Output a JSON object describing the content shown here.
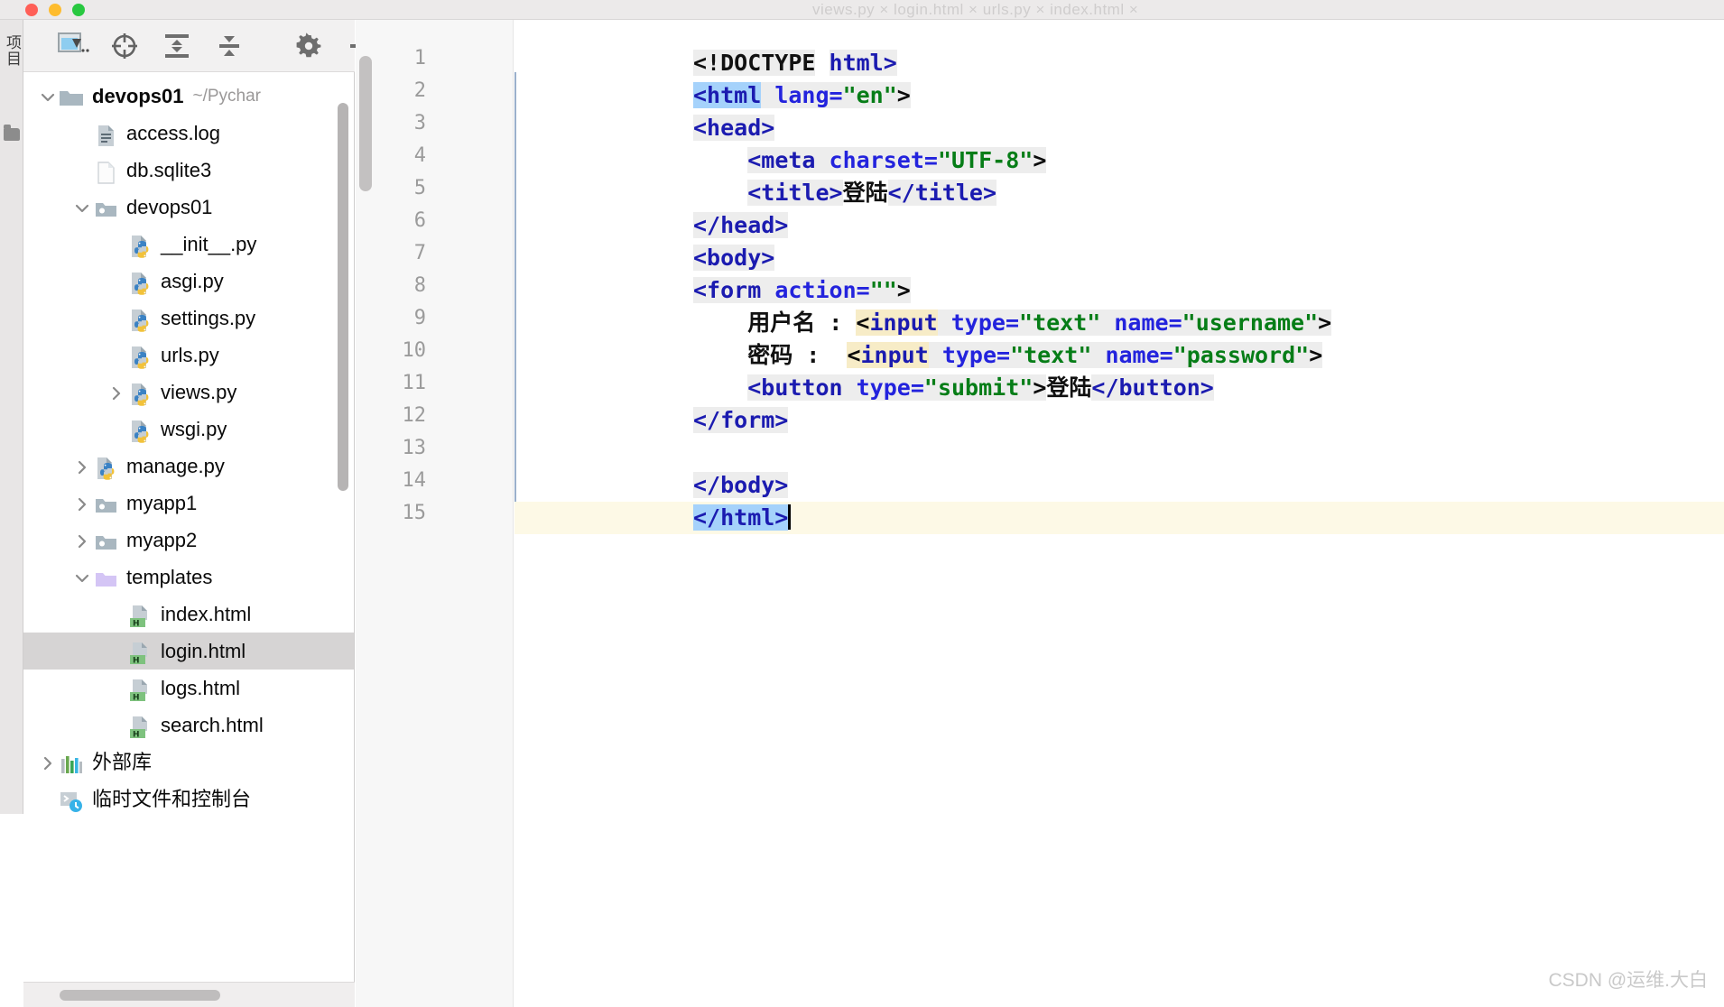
{
  "window": {
    "traffic_lights": [
      "close",
      "minimize",
      "zoom"
    ],
    "title_tabs_faint": "views.py  ×     login.html  ×     urls.py  ×     index.html  ×"
  },
  "sidebar": {
    "vertical_tab_label": "项目",
    "toolbar": [
      {
        "name": "select-opened-file-button",
        "icon": "file-select-icon",
        "tooltip": "Select Opened File"
      },
      {
        "name": "scroll-from-source-button",
        "icon": "crosshair-target-icon",
        "tooltip": "Scroll from Source"
      },
      {
        "name": "expand-all-button",
        "icon": "expand-all-icon",
        "tooltip": "Expand All"
      },
      {
        "name": "collapse-all-button",
        "icon": "collapse-all-icon",
        "tooltip": "Collapse All"
      },
      {
        "name": "settings-button",
        "icon": "gear-icon",
        "tooltip": "Options"
      },
      {
        "name": "hide-button",
        "icon": "minus-icon",
        "tooltip": "Hide"
      }
    ],
    "tree": [
      {
        "label": "devops01",
        "path": "~/Pychar",
        "icon": "folder-icon",
        "arrow": "expanded",
        "indent": 0,
        "bold": true,
        "selected": false
      },
      {
        "label": "access.log",
        "path": "",
        "icon": "log-file-icon",
        "arrow": "none",
        "indent": 1,
        "bold": false,
        "selected": false
      },
      {
        "label": "db.sqlite3",
        "path": "",
        "icon": "blank-file-icon",
        "arrow": "none",
        "indent": 1,
        "bold": false,
        "selected": false
      },
      {
        "label": "devops01",
        "path": "",
        "icon": "module-folder-icon",
        "arrow": "expanded",
        "indent": 1,
        "bold": false,
        "selected": false
      },
      {
        "label": "__init__.py",
        "path": "",
        "icon": "python-file-icon",
        "arrow": "none",
        "indent": 2,
        "bold": false,
        "selected": false
      },
      {
        "label": "asgi.py",
        "path": "",
        "icon": "python-file-icon",
        "arrow": "none",
        "indent": 2,
        "bold": false,
        "selected": false
      },
      {
        "label": "settings.py",
        "path": "",
        "icon": "python-file-icon",
        "arrow": "none",
        "indent": 2,
        "bold": false,
        "selected": false
      },
      {
        "label": "urls.py",
        "path": "",
        "icon": "python-file-icon",
        "arrow": "none",
        "indent": 2,
        "bold": false,
        "selected": false
      },
      {
        "label": "views.py",
        "path": "",
        "icon": "python-file-icon",
        "arrow": "collapsed",
        "indent": 2,
        "bold": false,
        "selected": false
      },
      {
        "label": "wsgi.py",
        "path": "",
        "icon": "python-file-icon",
        "arrow": "none",
        "indent": 2,
        "bold": false,
        "selected": false
      },
      {
        "label": "manage.py",
        "path": "",
        "icon": "python-file-icon",
        "arrow": "collapsed",
        "indent": 1,
        "bold": false,
        "selected": false
      },
      {
        "label": "myapp1",
        "path": "",
        "icon": "module-folder-icon",
        "arrow": "collapsed",
        "indent": 1,
        "bold": false,
        "selected": false
      },
      {
        "label": "myapp2",
        "path": "",
        "icon": "module-folder-icon",
        "arrow": "collapsed",
        "indent": 1,
        "bold": false,
        "selected": false
      },
      {
        "label": "templates",
        "path": "",
        "icon": "templates-folder-icon",
        "arrow": "expanded",
        "indent": 1,
        "bold": false,
        "selected": false
      },
      {
        "label": "index.html",
        "path": "",
        "icon": "html-file-icon",
        "arrow": "none",
        "indent": 2,
        "bold": false,
        "selected": false
      },
      {
        "label": "login.html",
        "path": "",
        "icon": "html-file-icon",
        "arrow": "none",
        "indent": 2,
        "bold": false,
        "selected": true
      },
      {
        "label": "logs.html",
        "path": "",
        "icon": "html-file-icon",
        "arrow": "none",
        "indent": 2,
        "bold": false,
        "selected": false
      },
      {
        "label": "search.html",
        "path": "",
        "icon": "html-file-icon",
        "arrow": "none",
        "indent": 2,
        "bold": false,
        "selected": false
      },
      {
        "label": "外部库",
        "path": "",
        "icon": "external-libraries-icon",
        "arrow": "collapsed",
        "indent": 0,
        "bold": false,
        "selected": false
      },
      {
        "label": "临时文件和控制台",
        "path": "",
        "icon": "scratches-consoles-icon",
        "arrow": "none",
        "indent": 0,
        "bold": false,
        "selected": false
      }
    ]
  },
  "editor": {
    "language": "HTML",
    "current_line": 15,
    "line_numbers": [
      1,
      2,
      3,
      4,
      5,
      6,
      7,
      8,
      9,
      10,
      11,
      12,
      13,
      14,
      15
    ],
    "lines": [
      {
        "n": 1,
        "text": "<!DOCTYPE html>"
      },
      {
        "n": 2,
        "text": "<html lang=\"en\">"
      },
      {
        "n": 3,
        "text": "<head>"
      },
      {
        "n": 4,
        "text": "    <meta charset=\"UTF-8\">"
      },
      {
        "n": 5,
        "text": "    <title>登陆</title>"
      },
      {
        "n": 6,
        "text": "</head>"
      },
      {
        "n": 7,
        "text": "<body>"
      },
      {
        "n": 8,
        "text": "<form action=\"\">"
      },
      {
        "n": 9,
        "text": "    用户名 : <input type=\"text\" name=\"username\">"
      },
      {
        "n": 10,
        "text": "    密码 :  <input type=\"text\" name=\"password\">"
      },
      {
        "n": 11,
        "text": "    <button type=\"submit\">登陆</button>"
      },
      {
        "n": 12,
        "text": "</form>"
      },
      {
        "n": 13,
        "text": ""
      },
      {
        "n": 14,
        "text": "</body>"
      },
      {
        "n": 15,
        "text": "</html>"
      }
    ],
    "page_title_text": "登陆",
    "button_text": "登陆",
    "label_username": "用户名 :",
    "label_password": "密码 :",
    "colors": {
      "tag": "#1b1bb0",
      "attribute": "#2323dd",
      "attribute_value": "#067d17",
      "token_highlight": "#ededed",
      "selection": "#a5d2fb",
      "warning_highlight": "#f7ecc7",
      "caret_line": "#fdf9e6"
    }
  },
  "watermark": {
    "text": "CSDN @运维.大白"
  }
}
